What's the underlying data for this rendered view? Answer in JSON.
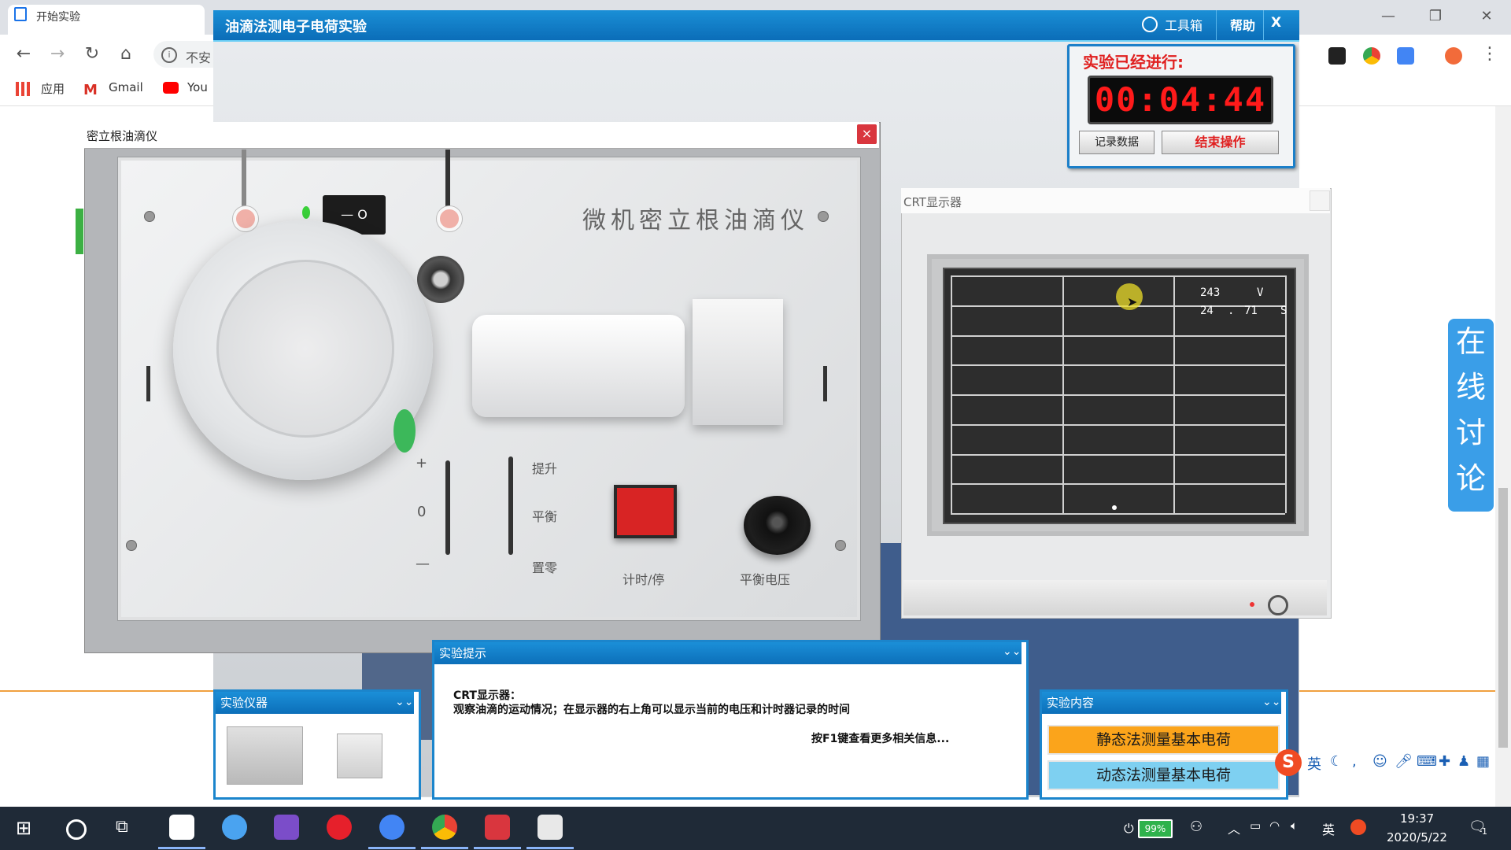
{
  "browser": {
    "tab_title": "开始实验",
    "address_text": "不安",
    "bookmarks": [
      "应用",
      "Gmail",
      "You"
    ],
    "window_controls": [
      "—",
      "❐",
      "✕"
    ]
  },
  "app": {
    "title": "油滴法测电子电荷实验",
    "toolbox_label": "工具箱",
    "help_label": "帮助",
    "close_label": "X"
  },
  "timer": {
    "label": "实验已经进行:",
    "value": "00:04:44",
    "record_button": "记录数据",
    "end_button": "结束操作"
  },
  "instrument": {
    "window_title": "密立根油滴仪",
    "close_label": "×",
    "brand": "微机密立根油滴仪",
    "switch_label": "— O",
    "polarity_plus": "+",
    "polarity_zero": "0",
    "polarity_minus": "—",
    "mode_up": "提升",
    "mode_balance": "平衡",
    "mode_zero": "置零",
    "timer_button_label": "计时/停",
    "voltage_knob_label": "平衡电压"
  },
  "crt": {
    "window_title": "CRT显示器",
    "voltage_value": "243",
    "voltage_unit": "V",
    "time_int": "24",
    "time_dot": ".",
    "time_frac": "71",
    "time_unit": "S"
  },
  "panels": {
    "instruments_title": "实验仪器",
    "hint_title": "实验提示",
    "hint_line1": "CRT显示器：",
    "hint_line2": "观察油滴的运动情况；在显示器的右上角可以显示当前的电压和计时器记录的时间",
    "hint_line3": "按F1键查看更多相关信息...",
    "content_title": "实验内容",
    "content_options": [
      "静态法测量基本电荷",
      "动态法测量基本电荷"
    ]
  },
  "sidebar_discuss": [
    "在",
    "线",
    "讨",
    "论"
  ],
  "ime": {
    "mode": "英",
    "logo": "S"
  },
  "taskbar": {
    "battery": "99%",
    "ime_indicator": "英",
    "time": "19:37",
    "date": "2020/5/22",
    "notification_count": "1"
  },
  "colors": {
    "app_title_bar": "#0b6db8",
    "timer_red": "#ff1a1a",
    "static_button": "#fba41b",
    "dynamic_button": "#7ed0f1",
    "discuss_blue": "#3a9ee8"
  }
}
